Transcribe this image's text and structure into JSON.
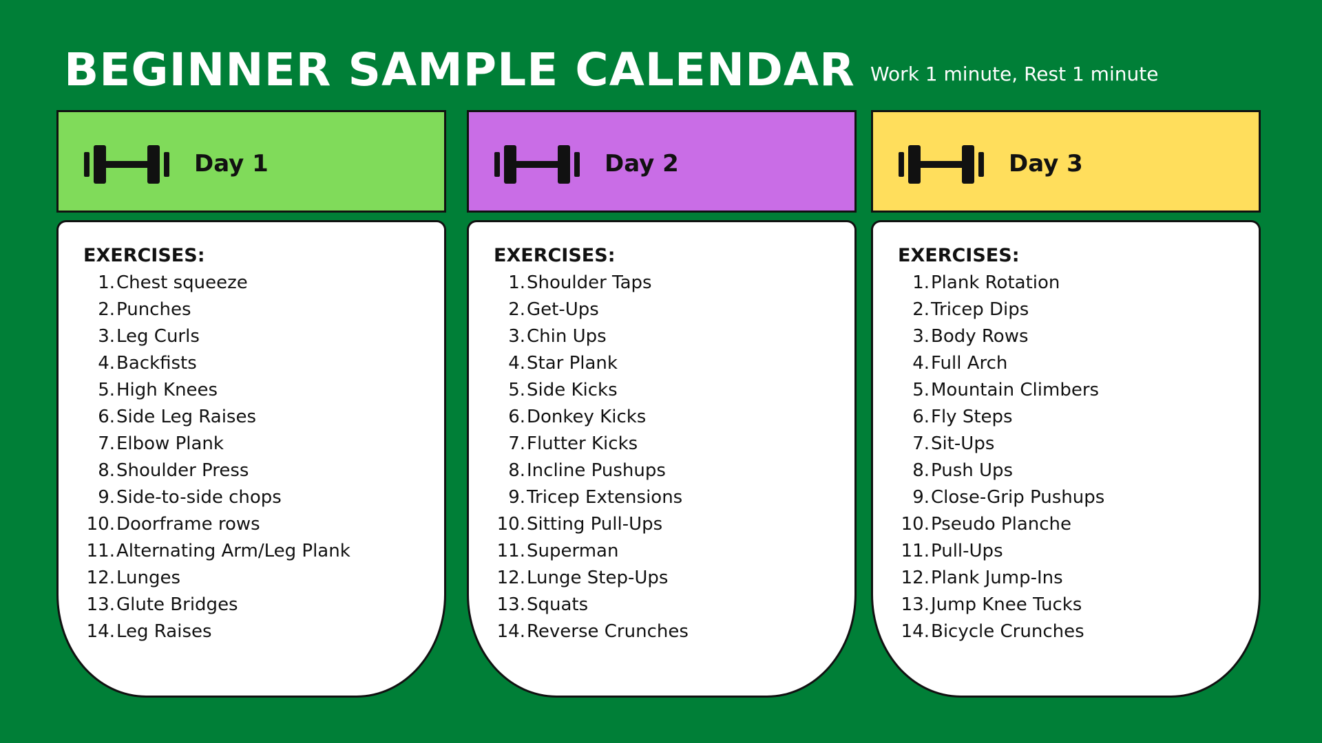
{
  "title": "BEGINNER SAMPLE CALENDAR",
  "subtitle": "Work 1 minute, Rest 1 minute",
  "colors": {
    "background": "#007f37",
    "day1": "#80db5a",
    "day2": "#c96de6",
    "day3": "#ffde5c"
  },
  "icon": "dumbbell-icon",
  "exercises_heading": "EXERCISES:",
  "days": [
    {
      "label": "Day 1",
      "exercises": [
        {
          "num": "1.",
          "name": "Chest squeeze"
        },
        {
          "num": "2.",
          "name": "Punches"
        },
        {
          "num": "3.",
          "name": "Leg Curls"
        },
        {
          "num": "4.",
          "name": "Backfists"
        },
        {
          "num": "5.",
          "name": "High Knees"
        },
        {
          "num": "6.",
          "name": "Side Leg Raises"
        },
        {
          "num": "7.",
          "name": "Elbow Plank"
        },
        {
          "num": "8.",
          "name": "Shoulder Press"
        },
        {
          "num": "9.",
          "name": "Side-to-side chops"
        },
        {
          "num": "10.",
          "name": "Doorframe rows"
        },
        {
          "num": "11.",
          "name": "Alternating Arm/Leg Plank"
        },
        {
          "num": "12.",
          "name": "Lunges"
        },
        {
          "num": "13.",
          "name": "Glute Bridges"
        },
        {
          "num": "14.",
          "name": "Leg Raises"
        }
      ]
    },
    {
      "label": "Day 2",
      "exercises": [
        {
          "num": "1.",
          "name": "Shoulder Taps"
        },
        {
          "num": "2.",
          "name": "Get-Ups"
        },
        {
          "num": "3.",
          "name": "Chin Ups"
        },
        {
          "num": "4.",
          "name": "Star Plank"
        },
        {
          "num": "5.",
          "name": "Side Kicks"
        },
        {
          "num": "6.",
          "name": "Donkey Kicks"
        },
        {
          "num": "7.",
          "name": "Flutter Kicks"
        },
        {
          "num": "8.",
          "name": "Incline Pushups"
        },
        {
          "num": "9.",
          "name": "Tricep Extensions"
        },
        {
          "num": "10.",
          "name": "Sitting Pull-Ups"
        },
        {
          "num": "11.",
          "name": "Superman"
        },
        {
          "num": "12.",
          "name": "Lunge Step-Ups"
        },
        {
          "num": "13.",
          "name": "Squats"
        },
        {
          "num": "14.",
          "name": "Reverse Crunches"
        }
      ]
    },
    {
      "label": "Day 3",
      "exercises": [
        {
          "num": "1.",
          "name": "Plank Rotation"
        },
        {
          "num": "2.",
          "name": "Tricep Dips"
        },
        {
          "num": "3.",
          "name": "Body Rows"
        },
        {
          "num": "4.",
          "name": "Full Arch"
        },
        {
          "num": "5.",
          "name": "Mountain Climbers"
        },
        {
          "num": "6.",
          "name": "Fly Steps"
        },
        {
          "num": "7.",
          "name": "Sit-Ups"
        },
        {
          "num": "8.",
          "name": "Push Ups"
        },
        {
          "num": "9.",
          "name": "Close-Grip Pushups"
        },
        {
          "num": "10.",
          "name": "Pseudo Planche"
        },
        {
          "num": "11.",
          "name": "Pull-Ups"
        },
        {
          "num": "12.",
          "name": "Plank Jump-Ins"
        },
        {
          "num": "13.",
          "name": "Jump Knee Tucks"
        },
        {
          "num": "14.",
          "name": "Bicycle Crunches"
        }
      ]
    }
  ]
}
